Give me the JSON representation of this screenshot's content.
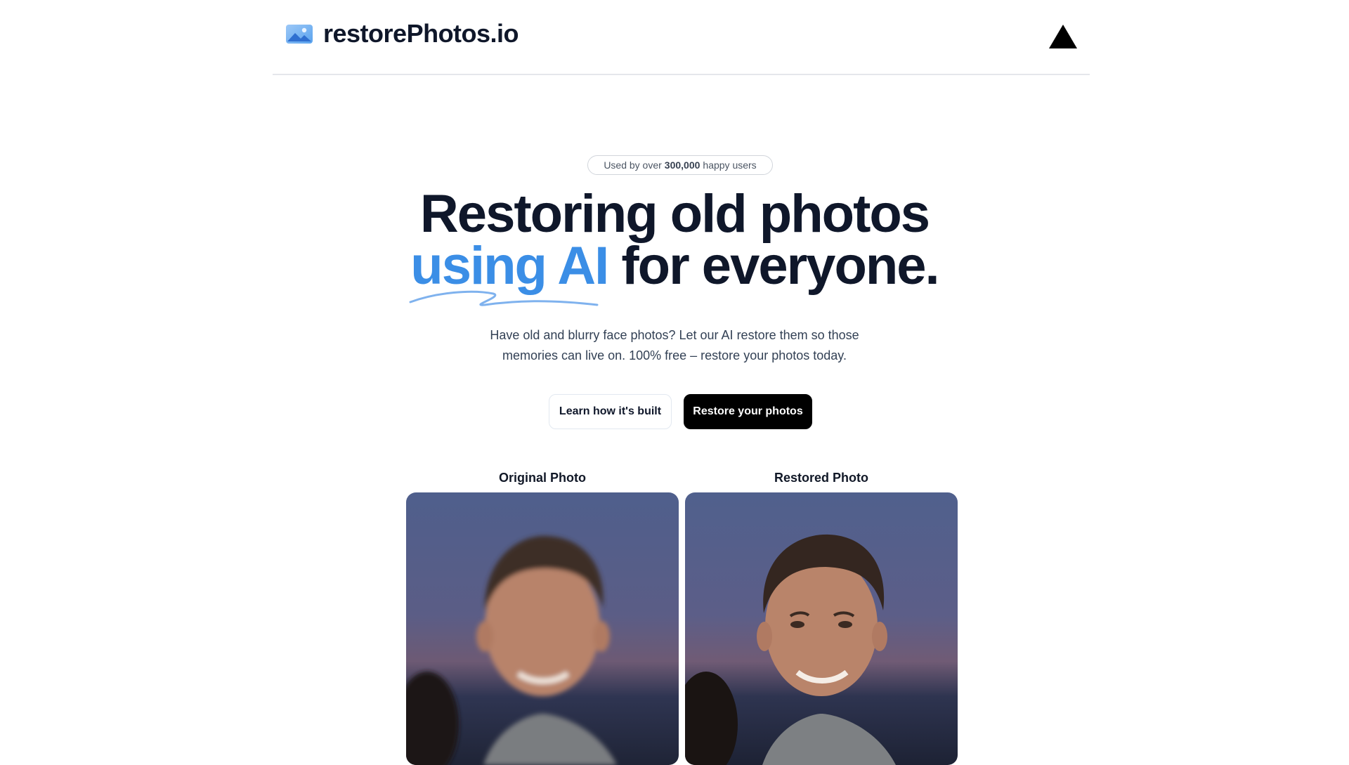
{
  "header": {
    "brand_name": "restorePhotos.io",
    "brand_icon": "photo-icon",
    "vercel_icon": "vercel-triangle-icon"
  },
  "hero": {
    "pill_prefix": "Used by over",
    "pill_count": "300,000",
    "pill_suffix": "happy users",
    "title_line1": "Restoring old photos",
    "title_accent": "using AI",
    "title_rest": "for everyone.",
    "subtitle": "Have old and blurry face photos? Let our AI restore them so those memories can live on. 100% free – restore your photos today.",
    "secondary_cta": "Learn how it's built",
    "primary_cta": "Restore your photos"
  },
  "comparison": {
    "original_label": "Original Photo",
    "restored_label": "Restored Photo"
  },
  "colors": {
    "accent": "#3b8ee6",
    "text": "#0f172a",
    "primary_button": "#000000"
  }
}
